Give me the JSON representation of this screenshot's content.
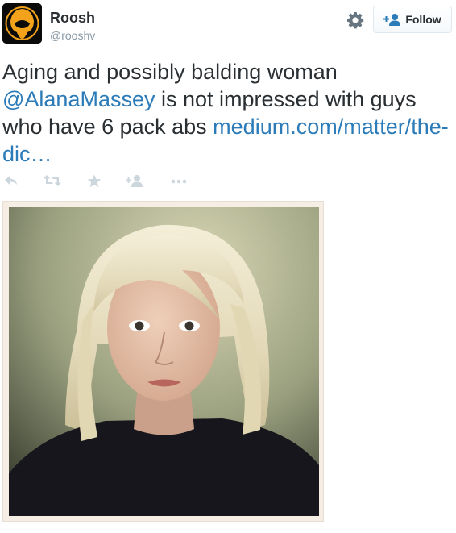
{
  "user": {
    "name": "Roosh",
    "handle": "@rooshv"
  },
  "follow_button": {
    "label": "Follow",
    "icon": "add-user-icon"
  },
  "settings_icon": "gear-icon",
  "tweet": {
    "text_before": "Aging and possibly balding woman ",
    "mention": "@AlanaMassey",
    "text_after": " is not impressed with guys who have 6 pack abs ",
    "link": "medium.com/matter/the-dic…"
  },
  "actions": [
    {
      "name": "reply",
      "icon": "reply-icon"
    },
    {
      "name": "retweet",
      "icon": "retweet-icon"
    },
    {
      "name": "favorite",
      "icon": "star-icon"
    },
    {
      "name": "follow",
      "icon": "add-user-icon"
    },
    {
      "name": "more",
      "icon": "more-icon"
    }
  ],
  "colors": {
    "link": "#2b7bb9",
    "text": "#292f33",
    "muted": "#8899a6",
    "action_icons": "#ccd6dd"
  }
}
